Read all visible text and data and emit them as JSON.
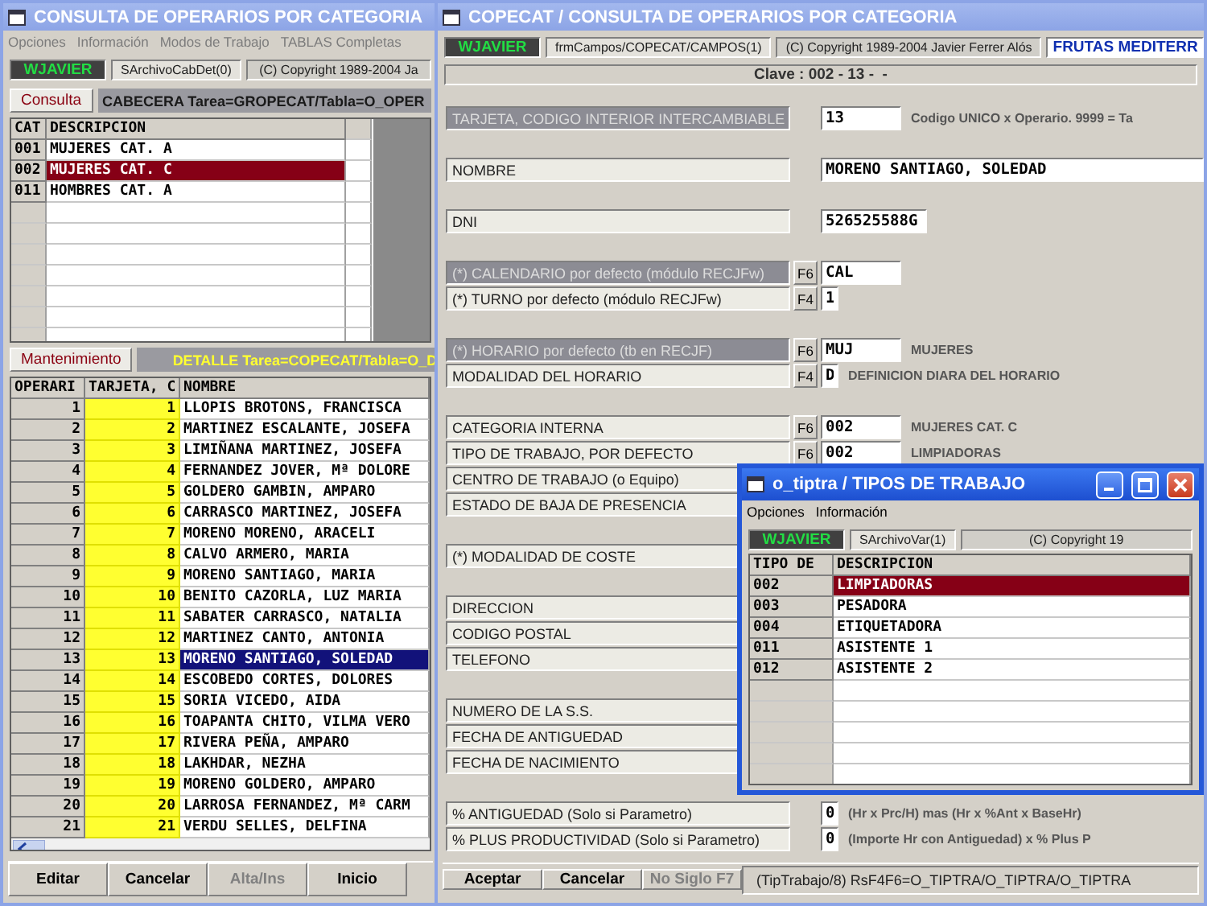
{
  "main_window": {
    "title": "CONSULTA DE OPERARIOS POR CATEGORIA",
    "menu": [
      {
        "label": "Opciones",
        "disabled": true
      },
      {
        "label": "Información",
        "disabled": true
      },
      {
        "label": "Modos de Trabajo",
        "disabled": true
      },
      {
        "label": "TABLAS Completas",
        "disabled": true
      }
    ],
    "status": [
      {
        "kind": "user",
        "text": "WJAVIER"
      },
      {
        "kind": "file",
        "text": "SArchivoCabDet(0)"
      },
      {
        "kind": "copyright",
        "text": "(C) Copyright 1989-2004 Ja"
      }
    ],
    "header_section": {
      "tab": "Consulta",
      "caption": "CABECERA Tarea=GROPECAT/Tabla=O_OPER"
    },
    "categories": {
      "columns": [
        "CAT",
        "DESCRIPCION"
      ],
      "rows": [
        {
          "code": "001",
          "description": "MUJERES CAT. A",
          "selected": false
        },
        {
          "code": "002",
          "description": "MUJERES CAT. C",
          "selected": true
        },
        {
          "code": "011",
          "description": "HOMBRES CAT. A",
          "selected": false
        }
      ]
    },
    "detail_section": {
      "tab": "Mantenimiento",
      "caption": "DETALLE Tarea=COPECAT/Tabla=O_D"
    },
    "operators": {
      "columns": [
        "OPERARI",
        "TARJETA, C",
        "NOMBRE"
      ],
      "rows": [
        {
          "id": "1",
          "card": "1",
          "name": "LLOPIS BROTONS, FRANCISCA",
          "selected": false
        },
        {
          "id": "2",
          "card": "2",
          "name": "MARTINEZ ESCALANTE, JOSEFA",
          "selected": false
        },
        {
          "id": "3",
          "card": "3",
          "name": "LIMIÑANA MARTINEZ, JOSEFA",
          "selected": false
        },
        {
          "id": "4",
          "card": "4",
          "name": "FERNANDEZ JOVER, Mª DOLORE",
          "selected": false
        },
        {
          "id": "5",
          "card": "5",
          "name": "GOLDERO GAMBIN, AMPARO",
          "selected": false
        },
        {
          "id": "6",
          "card": "6",
          "name": "CARRASCO MARTINEZ, JOSEFA",
          "selected": false
        },
        {
          "id": "7",
          "card": "7",
          "name": "MORENO MORENO, ARACELI",
          "selected": false
        },
        {
          "id": "8",
          "card": "8",
          "name": "CALVO ARMERO, MARIA",
          "selected": false
        },
        {
          "id": "9",
          "card": "9",
          "name": "MORENO SANTIAGO, MARIA",
          "selected": false
        },
        {
          "id": "10",
          "card": "10",
          "name": "BENITO CAZORLA, LUZ MARIA",
          "selected": false
        },
        {
          "id": "11",
          "card": "11",
          "name": "SABATER CARRASCO, NATALIA",
          "selected": false
        },
        {
          "id": "12",
          "card": "12",
          "name": "MARTINEZ CANTO, ANTONIA",
          "selected": false
        },
        {
          "id": "13",
          "card": "13",
          "name": "MORENO SANTIAGO, SOLEDAD",
          "selected": true
        },
        {
          "id": "14",
          "card": "14",
          "name": "ESCOBEDO CORTES, DOLORES",
          "selected": false
        },
        {
          "id": "15",
          "card": "15",
          "name": "SORIA VICEDO, AIDA",
          "selected": false
        },
        {
          "id": "16",
          "card": "16",
          "name": "TOAPANTA CHITO, VILMA VERO",
          "selected": false
        },
        {
          "id": "17",
          "card": "17",
          "name": "RIVERA PEÑA, AMPARO",
          "selected": false
        },
        {
          "id": "18",
          "card": "18",
          "name": "LAKHDAR, NEZHA",
          "selected": false
        },
        {
          "id": "19",
          "card": "19",
          "name": "MORENO GOLDERO, AMPARO",
          "selected": false
        },
        {
          "id": "20",
          "card": "20",
          "name": "LARROSA FERNANDEZ, Mª CARM",
          "selected": false
        },
        {
          "id": "21",
          "card": "21",
          "name": "VERDU SELLES, DELFINA",
          "selected": false
        }
      ]
    },
    "buttons": [
      {
        "label": "Editar",
        "disabled": false
      },
      {
        "label": "Cancelar",
        "disabled": false
      },
      {
        "label": "Alta/Ins",
        "disabled": true
      },
      {
        "label": "Inicio",
        "disabled": false
      }
    ]
  },
  "detail_window": {
    "title": "COPECAT / CONSULTA DE OPERARIOS POR CATEGORIA",
    "status": [
      {
        "kind": "user",
        "text": "WJAVIER"
      },
      {
        "kind": "file",
        "text": "frmCampos/COPECAT/CAMPOS(1)"
      },
      {
        "kind": "copyright",
        "text": "(C) Copyright 1989-2004 Javier Ferrer Alós"
      },
      {
        "kind": "company",
        "text": "FRUTAS MEDITERR"
      }
    ],
    "key": "Clave : 002 - 13 -  -",
    "field_groups": [
      [
        {
          "label": "TARJETA, CODIGO INTERIOR INTERCAMBIABLE",
          "highlighted": true,
          "value": "13",
          "note": "Codigo UNICO x Operario. 9999 = Ta"
        }
      ],
      [
        {
          "label": "NOMBRE",
          "highlighted": false,
          "value": "MORENO SANTIAGO, SOLEDAD"
        }
      ],
      [
        {
          "label": "DNI",
          "highlighted": false,
          "value": "526525588G"
        }
      ],
      [
        {
          "label": "(*) CALENDARIO por defecto (módulo RECJFw)",
          "highlighted": true,
          "fkey": "F6",
          "value": "CAL"
        },
        {
          "label": "(*) TURNO por defecto (módulo RECJFw)",
          "highlighted": false,
          "fkey": "F4",
          "value": "1"
        }
      ],
      [
        {
          "label": "(*) HORARIO por defecto (tb en RECJF)",
          "highlighted": true,
          "fkey": "F6",
          "value": "MUJ",
          "note": "MUJERES"
        },
        {
          "label": "MODALIDAD DEL HORARIO",
          "highlighted": false,
          "fkey": "F4",
          "value": "D",
          "note": "DEFINICION DIARA DEL HORARIO"
        }
      ],
      [
        {
          "label": "CATEGORIA INTERNA",
          "highlighted": false,
          "fkey": "F6",
          "value": "002",
          "note": "MUJERES CAT. C"
        },
        {
          "label": "TIPO DE TRABAJO, POR DEFECTO",
          "highlighted": false,
          "fkey": "F6",
          "value": "002",
          "note": "LIMPIADORAS"
        },
        {
          "label": "CENTRO DE TRABAJO (o Equipo)",
          "highlighted": false
        },
        {
          "label": "ESTADO DE BAJA DE PRESENCIA",
          "highlighted": false
        }
      ],
      [
        {
          "label": "(*) MODALIDAD DE COSTE",
          "highlighted": false
        }
      ],
      [
        {
          "label": "DIRECCION",
          "highlighted": false
        },
        {
          "label": "CODIGO POSTAL",
          "highlighted": false
        },
        {
          "label": "TELEFONO",
          "highlighted": false
        }
      ],
      [
        {
          "label": "NUMERO DE LA S.S.",
          "highlighted": false
        },
        {
          "label": "FECHA DE ANTIGUEDAD",
          "highlighted": false
        },
        {
          "label": "FECHA DE NACIMIENTO",
          "highlighted": false
        }
      ],
      [
        {
          "label": "% ANTIGUEDAD (Solo si Parametro)",
          "highlighted": false,
          "value": "0",
          "note": "(Hr x Prc/H) mas (Hr x %Ant x BaseHr)"
        },
        {
          "label": "% PLUS PRODUCTIVIDAD (Solo si Parametro)",
          "highlighted": false,
          "value": "0",
          "note": "(Importe Hr con Antiguedad) x % Plus P"
        }
      ]
    ],
    "buttons": [
      {
        "label": "Aceptar",
        "disabled": false
      },
      {
        "label": "Cancelar",
        "disabled": false
      },
      {
        "label": "No Siglo F7",
        "disabled": true
      }
    ],
    "status_text": "(TipTrabajo/8) RsF4F6=O_TIPTRA/O_TIPTRA/O_TIPTRA"
  },
  "popup_window": {
    "title": "o_tiptra / TIPOS DE TRABAJO",
    "menu": [
      {
        "label": "Opciones",
        "disabled": false
      },
      {
        "label": "Información",
        "disabled": false
      }
    ],
    "status": [
      {
        "kind": "user",
        "text": "WJAVIER"
      },
      {
        "kind": "file",
        "text": "SArchivoVar(1)"
      },
      {
        "kind": "copyright",
        "text": "(C) Copyright 19"
      }
    ],
    "columns": [
      "TIPO DE",
      "DESCRIPCION"
    ],
    "rows": [
      {
        "code": "002",
        "description": "LIMPIADORAS",
        "selected": true
      },
      {
        "code": "003",
        "description": "PESADORA",
        "selected": false
      },
      {
        "code": "004",
        "description": "ETIQUETADORA",
        "selected": false
      },
      {
        "code": "011",
        "description": "ASISTENTE 1",
        "selected": false
      },
      {
        "code": "012",
        "description": "ASISTENTE 2",
        "selected": false
      }
    ]
  }
}
